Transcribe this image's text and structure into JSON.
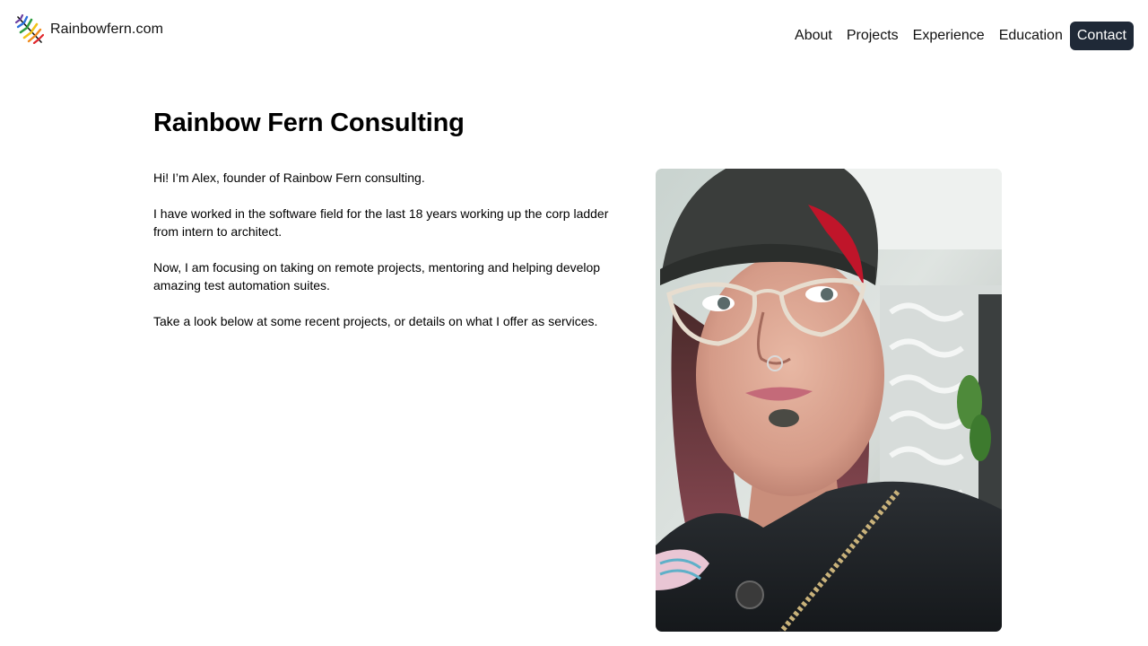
{
  "brand": {
    "name": "Rainbowfern.com",
    "logo_icon": "rainbow-fern-leaf-icon"
  },
  "nav": {
    "items": [
      {
        "label": "About"
      },
      {
        "label": "Projects"
      },
      {
        "label": "Experience"
      },
      {
        "label": "Education"
      },
      {
        "label": "Contact",
        "active": true
      }
    ]
  },
  "main": {
    "title": "Rainbow Fern Consulting",
    "paragraphs": [
      "Hi! I’m Alex, founder of Rainbow Fern consulting.",
      "I have worked in the software field for the last 18 years working up the corp ladder from intern to architect.",
      "Now, I am focusing on taking on remote projects, mentoring and helping develop amazing test automation suites.",
      "Take a look below at some recent projects, or details on what I offer as services."
    ],
    "portrait_icon": "portrait-photo"
  },
  "colors": {
    "contact_button_bg": "#1f2937",
    "contact_button_text": "#ffffff",
    "text": "#111111",
    "background": "#ffffff"
  }
}
